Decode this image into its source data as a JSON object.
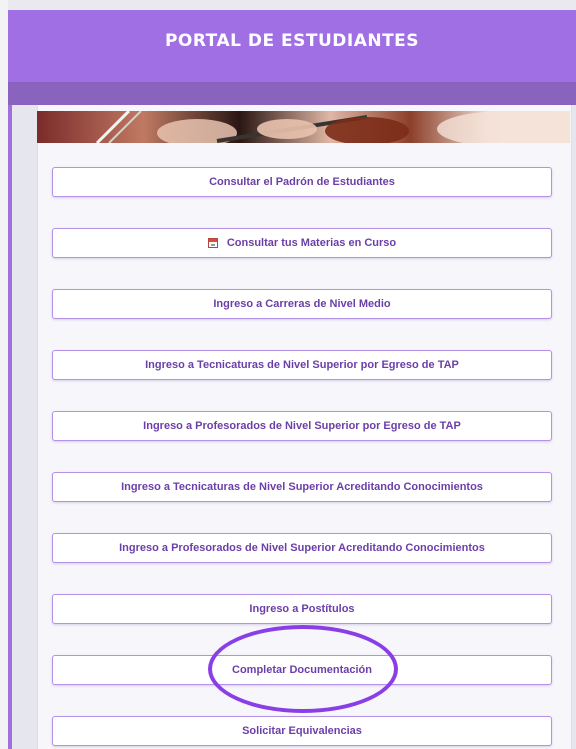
{
  "header": {
    "title": "PORTAL DE ESTUDIANTES"
  },
  "menu": {
    "items": [
      {
        "label": "Consultar el Padrón de Estudiantes",
        "icon": null
      },
      {
        "label": "Consultar tus Materias en Curso",
        "icon": "calendar-icon"
      },
      {
        "label": "Ingreso a Carreras de Nivel Medio",
        "icon": null
      },
      {
        "label": "Ingreso a Tecnicaturas de Nivel Superior por Egreso de TAP",
        "icon": null
      },
      {
        "label": "Ingreso a Profesorados de Nivel Superior por Egreso de TAP",
        "icon": null
      },
      {
        "label": "Ingreso a Tecnicaturas de Nivel Superior Acreditando Conocimientos",
        "icon": null
      },
      {
        "label": "Ingreso a Profesorados de Nivel Superior Acreditando Conocimientos",
        "icon": null
      },
      {
        "label": "Ingreso a Postítulos",
        "icon": null
      },
      {
        "label": "Completar Documentación",
        "icon": null
      },
      {
        "label": "Solicitar Equivalencias",
        "icon": null
      }
    ]
  },
  "colors": {
    "header_bg": "#a06fe4",
    "subbar_bg": "#8a63bf",
    "button_border": "#b392e8",
    "button_text": "#6b3fa8",
    "highlight_ring": "#8a3fe6"
  }
}
